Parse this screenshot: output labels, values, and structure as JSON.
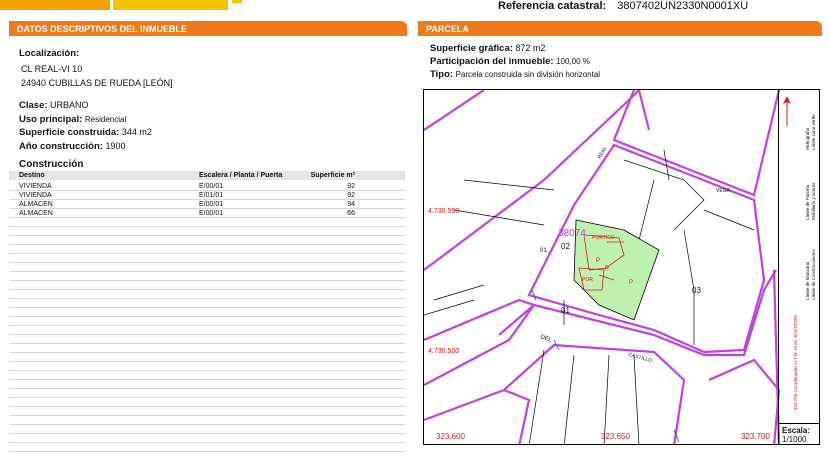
{
  "header": {
    "ref_label": "Referencia catastral:",
    "ref_value": "3807402UN2330N0001XU"
  },
  "left": {
    "title": "DATOS DESCRIPTIVOS DEL INMUEBLE",
    "loc_label": "Localización:",
    "addr1": "CL REAL-VI 10",
    "addr2": "24940 CUBILLAS DE RUEDA [LEÓN]",
    "clase_label": "Clase:",
    "clase_value": "URBANO",
    "uso_label": "Uso principal:",
    "uso_value": "Residencial",
    "sup_label": "Superficie construida:",
    "sup_value": "344 m2",
    "anio_label": "Año construcción:",
    "anio_value": "1900",
    "constr_title": "Construcción"
  },
  "table": {
    "headers": [
      "Destino",
      "Escalera / Planta / Puerta",
      "Superficie m²"
    ],
    "rows": [
      [
        "VIVIENDA",
        "E/00/01",
        "92"
      ],
      [
        "VIVIENDA",
        "E/01/01",
        "92"
      ],
      [
        "ALMACEN",
        "E/00/01",
        "94"
      ],
      [
        "ALMACEN",
        "E/00/01",
        "66"
      ]
    ]
  },
  "right": {
    "title": "PARCELA",
    "sg_label": "Superficie gráfica:",
    "sg_value": "872 m2",
    "part_label": "Participación del inmueble:",
    "part_value": "100,00 %",
    "tipo_label": "Tipo:",
    "tipo_value": "Parcela construida sin división horizontal"
  },
  "map": {
    "coords": [
      "4.730.550",
      "4.730.500",
      "323.600",
      "323.650",
      "323.700"
    ],
    "parcel_id": "38074",
    "parcel_code": "02",
    "labels": [
      "PORTICO",
      "P",
      "P",
      "POR",
      "P",
      "01",
      "03",
      "01",
      "DEL",
      "CASTILLO",
      "VEGA",
      "REAL"
    ],
    "legend": [
      "Límite de Manzana",
      "Límite de Parcela",
      "Límite de Construcciones",
      "Mobiliario y aceras",
      "Límite zona verde",
      "Hidrografía",
      "323.700 Coordenadas U.T.M. Huso 30 ETRS89"
    ],
    "scale_label": "Escala:",
    "scale_value": "1/1000"
  }
}
